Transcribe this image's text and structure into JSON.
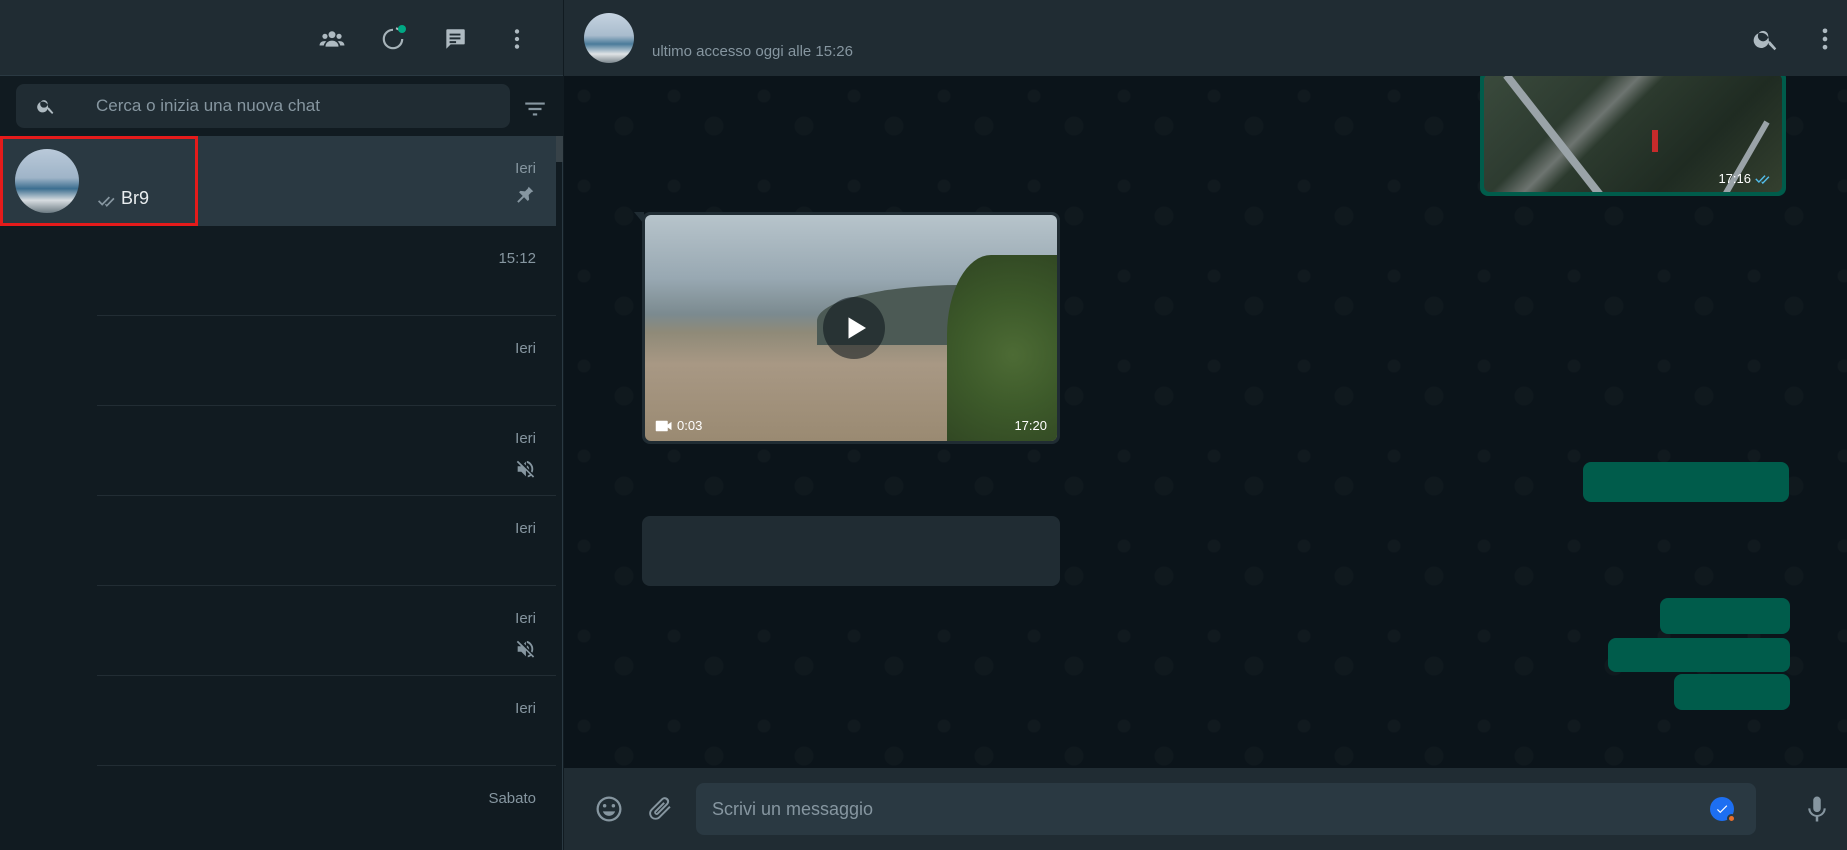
{
  "left_header": {
    "icons": [
      "community-icon",
      "status-icon",
      "new-chat-icon",
      "menu-icon"
    ]
  },
  "search": {
    "placeholder": "Cerca o inizia una nuova chat"
  },
  "chats": [
    {
      "name": "Br9",
      "time": "Ieri",
      "pinned": true,
      "muted": false,
      "read_ticks": true
    },
    {
      "name": "",
      "time": "15:12",
      "pinned": false,
      "muted": false
    },
    {
      "name": "",
      "time": "Ieri",
      "pinned": false,
      "muted": false
    },
    {
      "name": "",
      "time": "Ieri",
      "pinned": false,
      "muted": true
    },
    {
      "name": "",
      "time": "Ieri",
      "pinned": false,
      "muted": false
    },
    {
      "name": "",
      "time": "Ieri",
      "pinned": false,
      "muted": true
    },
    {
      "name": "",
      "time": "Ieri",
      "pinned": false,
      "muted": false
    },
    {
      "name": "",
      "time": "Sabato",
      "pinned": false,
      "muted": false
    }
  ],
  "conversation": {
    "status": "ultimo accesso oggi alle 15:26",
    "image_message": {
      "time": "17:16"
    },
    "video_message": {
      "duration": "0:03",
      "time": "17:20"
    }
  },
  "composer": {
    "placeholder": "Scrivi un messaggio"
  },
  "colors": {
    "accent": "#00a884",
    "outgoing": "#005c4b",
    "incoming": "#202c33",
    "highlight": "#e51b1b"
  }
}
